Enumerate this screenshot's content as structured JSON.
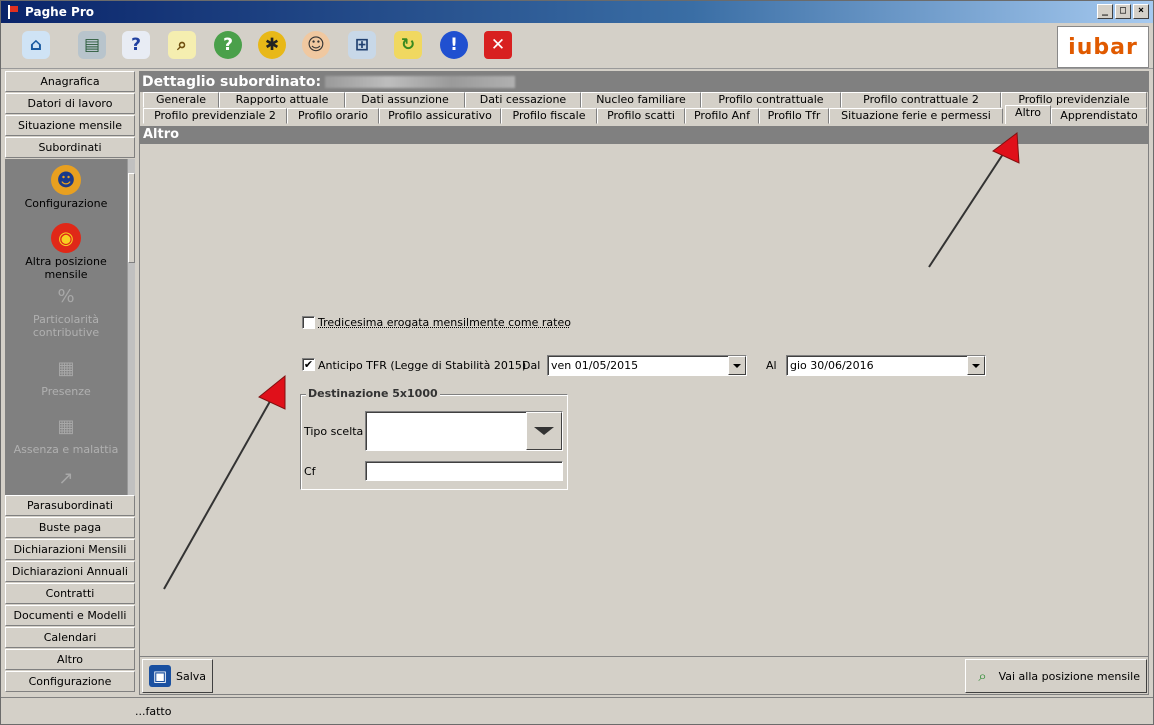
{
  "window": {
    "title": "Paghe Pro",
    "min": "_",
    "max": "□",
    "close": "×"
  },
  "toolbar": {
    "icons": [
      "home-icon",
      "printer-icon",
      "help-icon",
      "search-doc-icon",
      "globe-help-icon",
      "bug-icon",
      "support-agent-icon",
      "network-icon",
      "folder-refresh-icon",
      "info-icon",
      "exit-icon"
    ],
    "logo": "iubar"
  },
  "nav": {
    "top_items": [
      "Anagrafica",
      "Datori di lavoro",
      "Situazione mensile",
      "Subordinati"
    ],
    "panel_items": [
      {
        "label": "Configurazione",
        "enabled": true
      },
      {
        "label": "Altra posizione mensile",
        "enabled": true
      },
      {
        "label": "Particolarità contributive",
        "enabled": false
      },
      {
        "label": "Presenze",
        "enabled": false
      },
      {
        "label": "Assenza e malattia",
        "enabled": false
      }
    ],
    "bottom_items": [
      "Parasubordinati",
      "Buste paga",
      "Dichiarazioni Mensili",
      "Dichiarazioni Annuali",
      "Contratti",
      "Documenti e Modelli",
      "Calendari",
      "Altro",
      "Configurazione"
    ]
  },
  "detail": {
    "header": "Dettaglio subordinato:",
    "tabs_row1": [
      "Generale",
      "Rapporto attuale",
      "Dati assunzione",
      "Dati cessazione",
      "Nucleo familiare",
      "Profilo contrattuale",
      "Profilo contrattuale 2",
      "Profilo previdenziale"
    ],
    "tabs_row2": [
      "Profilo previdenziale 2",
      "Profilo orario",
      "Profilo assicurativo",
      "Profilo fiscale",
      "Profilo scatti",
      "Profilo Anf",
      "Profilo Tfr",
      "Situazione ferie e permessi",
      "Altro",
      "Apprendistato"
    ],
    "active_tab": "Altro",
    "section_title": "Altro"
  },
  "form": {
    "tredicesima": {
      "label": "Tredicesima erogata mensilmente come rateo",
      "checked": false
    },
    "anticipo": {
      "label": "Anticipo TFR (Legge di Stabilità 2015)",
      "checked": true,
      "check_mark": "✔"
    },
    "dal_label": "Dal",
    "dal_value": "ven 01/05/2015",
    "al_label": "Al",
    "al_value": "gio 30/06/2016",
    "group_title": "Destinazione 5x1000",
    "tipo_label": "Tipo scelta",
    "tipo_value": "",
    "cf_label": "Cf",
    "cf_value": ""
  },
  "buttons": {
    "save": "Salva",
    "go_monthly": "Vai alla posizione mensile"
  },
  "status": {
    "text": "...fatto"
  },
  "colors": {
    "annotation_arrow": "#e0101a",
    "header_bg": "#808080",
    "face": "#d4d0c8"
  }
}
